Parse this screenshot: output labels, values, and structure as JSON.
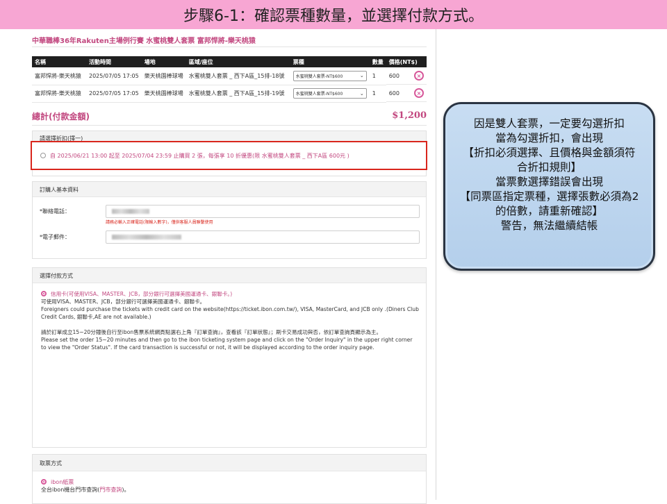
{
  "banner": {
    "title": "步驟6-1：確認票種數量，並選擇付款方式。"
  },
  "event": {
    "title": "中華職棒36年Rakuten主場例行賽 水蜜桃雙人套票 富邦悍將-樂天桃猿"
  },
  "ticket_table": {
    "headers": [
      "名稱",
      "活動時間",
      "場地",
      "區域/座位",
      "票種",
      "數量",
      "價格(NT$)"
    ],
    "rows": [
      {
        "name": "富邦悍將-樂天桃猿",
        "time": "2025/07/05 17:05",
        "venue": "樂天桃園棒球場",
        "seat": "水蜜桃雙人套票 _ 西下A區_15排-18號",
        "ticket_type": "水蜜桃雙人套票-NT$600",
        "qty": "1",
        "price": "600"
      },
      {
        "name": "富邦悍將-樂天桃猿",
        "time": "2025/07/05 17:05",
        "venue": "樂天桃園棒球場",
        "seat": "水蜜桃雙人套票 _ 西下A區_15排-19號",
        "ticket_type": "水蜜桃雙人套票-NT$600",
        "qty": "1",
        "price": "600"
      }
    ]
  },
  "total": {
    "label": "總計(付款金額)",
    "amount": "$1,200"
  },
  "discount": {
    "header": "請選擇折扣(擇一)",
    "option": "自 2025/06/21 13:00 起至 2025/07/04 23:59 止購買 2 張，每張享 10 折優惠(限 水蜜桃雙人套票 _ 西下A區 600元 )"
  },
  "buyer": {
    "header": "訂購人基本資料",
    "phone_label": "*聯絡電話：",
    "phone_hint": "請務必輸入正確電話(限輸入數字)，僅供客服人員聯繫使用",
    "email_label": "*電子郵件："
  },
  "payment": {
    "header": "選擇付款方式",
    "option_label": "信用卡(可使用VISA、MASTER、JCB，部分銀行可選擇美國運通卡、銀聯卡。)",
    "lines": [
      "可使用VISA、MASTER、JCB，部分銀行可選擇美國運通卡、銀聯卡。",
      "Foreigners could purchase the tickets with credit card on the website(https://ticket.ibon.com.tw/), VISA, MasterCard, and JCB only .(Diners Club Credit Cards, 銀聯卡,AE are not available.)",
      "請於訂單成立15~20分鐘後自行至ibon售票系統網頁點選右上角『訂單查詢』，查看該『訂單狀態』；刷卡交易成功與否，依訂單查詢頁顯示為主。",
      "Please set the order 15~20 minutes and then go to the ibon ticketing system page and click on the \"Order Inquiry\" in the upper right corner to view the \"Order Status\". If the card transaction is successful or not, it will be displayed according to the order inquiry page."
    ]
  },
  "pickup": {
    "header": "取票方式",
    "option_label": "ibon紙票",
    "desc_prefix": "全台ibon機台門市查詢(",
    "desc_link": "門市查詢",
    "desc_suffix": ")。"
  },
  "callout": {
    "lines": [
      "因是雙人套票，一定要勾選折扣",
      "當為勾選折扣，會出現",
      "【折扣必須選擇、且價格與金額須符合折扣規則】",
      "當票數選擇錯誤會出現",
      "【同票區指定票種，選擇張數必須為2的倍數，請重新確認】",
      "警告，無法繼續結帳"
    ]
  },
  "colors": {
    "banner": "#f7a6d3",
    "accent": "#c2477f",
    "highlight_border": "#d9251c",
    "callout_bg": "#c8ddf2"
  }
}
